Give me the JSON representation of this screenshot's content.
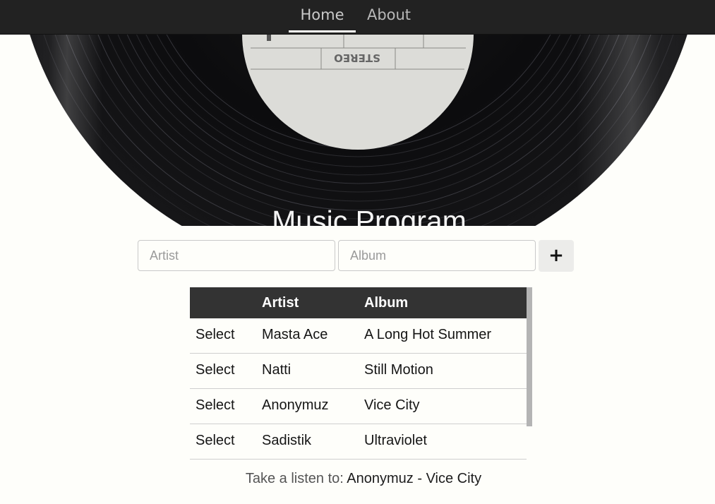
{
  "nav": {
    "items": [
      {
        "label": "Home",
        "active": true
      },
      {
        "label": "About",
        "active": false
      }
    ]
  },
  "hero": {
    "title": "Music Program",
    "label_text": "STEREO"
  },
  "form": {
    "artist_placeholder": "Artist",
    "album_placeholder": "Album",
    "add_label": "+"
  },
  "table": {
    "headers": [
      "",
      "Artist",
      "Album"
    ],
    "rows": [
      {
        "action": "Select",
        "artist": "Masta Ace",
        "album": "A Long Hot Summer"
      },
      {
        "action": "Select",
        "artist": "Natti",
        "album": "Still Motion"
      },
      {
        "action": "Select",
        "artist": "Anonymuz",
        "album": "Vice City"
      },
      {
        "action": "Select",
        "artist": "Sadistik",
        "album": "Ultraviolet"
      }
    ]
  },
  "footer": {
    "prefix": "Take a listen to: ",
    "selection": "Anonymuz - Vice City"
  },
  "colors": {
    "navbar": "#222222",
    "table_header": "#333333",
    "page_background": "#fefefa"
  }
}
